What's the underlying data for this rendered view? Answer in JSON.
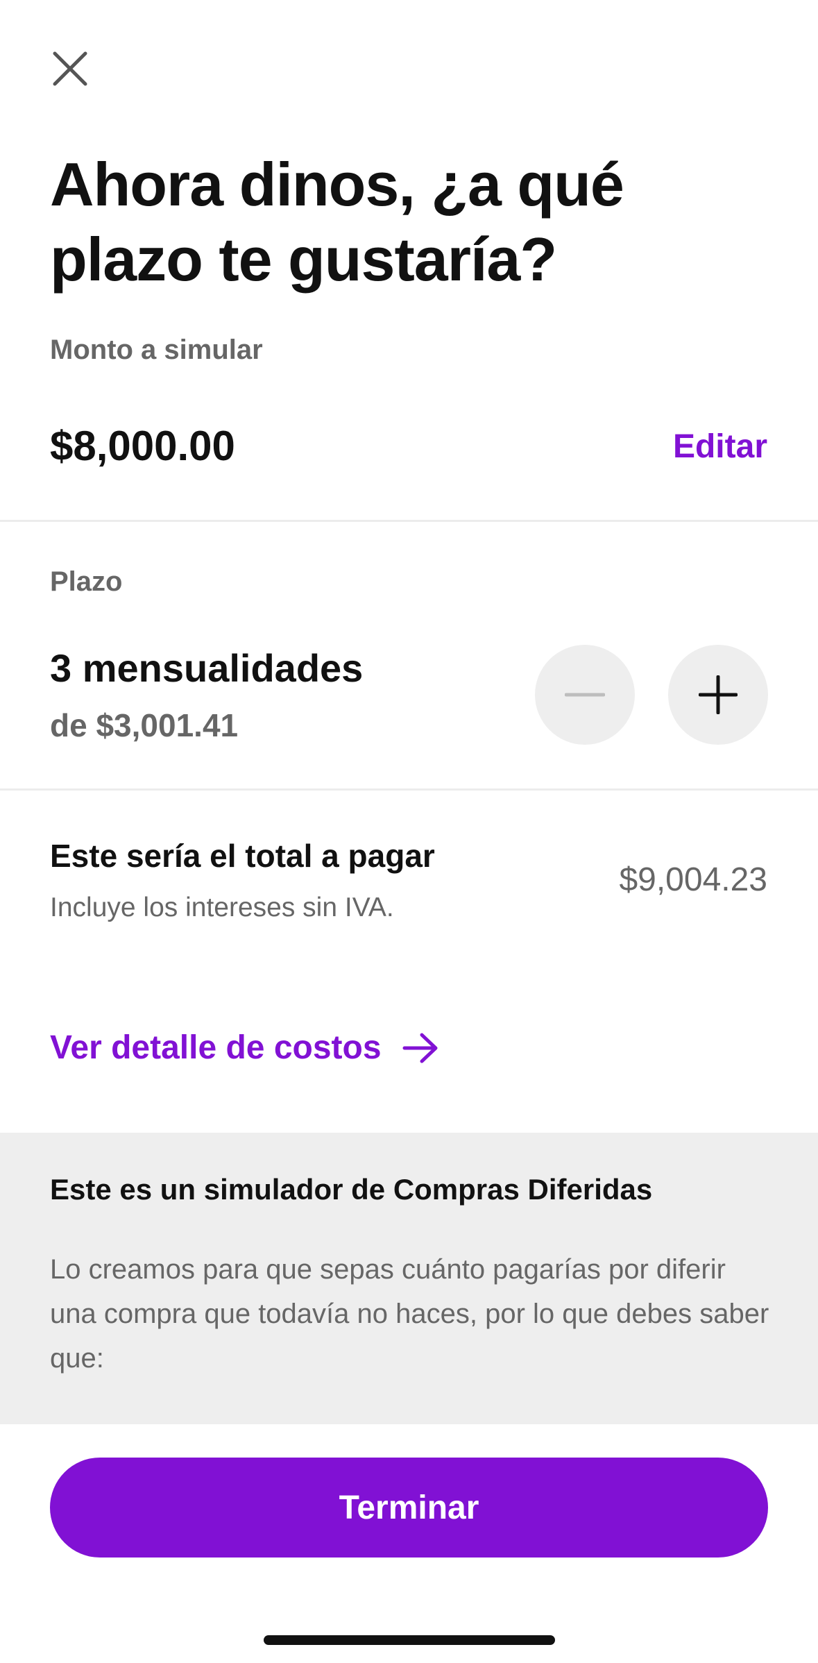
{
  "header": {
    "close_icon": "close-icon",
    "title": "Ahora dinos, ¿a qué plazo te gustaría?"
  },
  "amount": {
    "label": "Monto a simular",
    "value": "$8,000.00",
    "edit_label": "Editar"
  },
  "term": {
    "label": "Plazo",
    "count_text": "3 mensualidades",
    "monthly_text": "de $3,001.41",
    "decrease_icon": "minus-icon",
    "increase_icon": "plus-icon"
  },
  "total": {
    "title": "Este sería el total a pagar",
    "subtitle": "Incluye los intereses sin IVA.",
    "value": "$9,004.23"
  },
  "cost_detail": {
    "label": "Ver detalle de costos",
    "icon": "arrow-right-icon"
  },
  "info": {
    "title": "Este es un simulador de Compras Diferidas",
    "body": "Lo creamos para que sepas cuánto pagarías por diferir una compra que todavía no haces, por lo que debes saber que:"
  },
  "footer": {
    "finish_label": "Terminar"
  },
  "colors": {
    "accent": "#8111d4",
    "panel_background": "#eeeeee",
    "muted_text": "#666666"
  }
}
